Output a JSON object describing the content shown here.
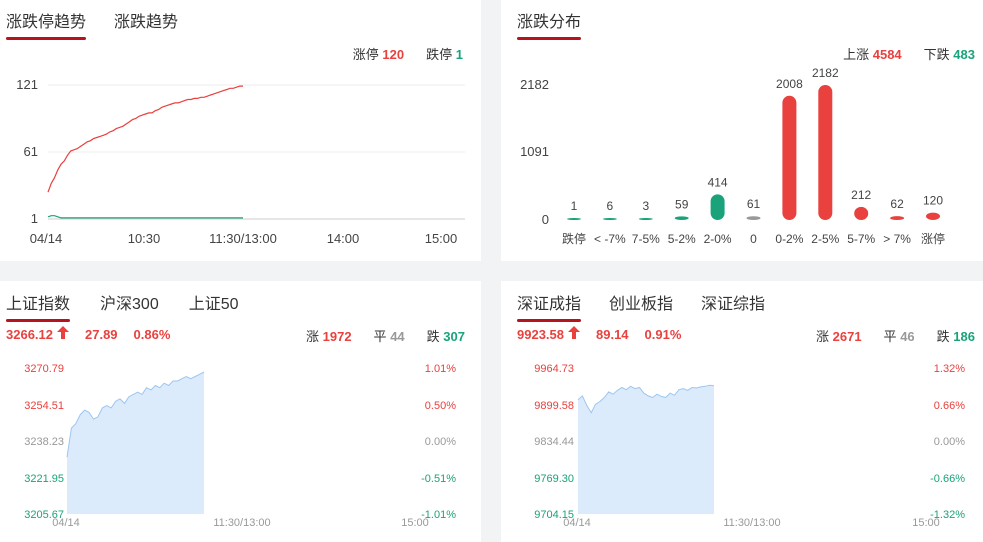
{
  "colors": {
    "up": "#e8413e",
    "down": "#1aa37a",
    "flat": "#999999",
    "accent": "#b5141e",
    "area": "#dcebfb"
  },
  "trend_panel": {
    "tabs": [
      "涨跌停趋势",
      "涨跌趋势"
    ],
    "limit_up_label": "涨停",
    "limit_up_value": "120",
    "limit_down_label": "跌停",
    "limit_down_value": "1",
    "y_ticks": [
      "121",
      "61",
      "1"
    ],
    "x_ticks": [
      "04/14",
      "10:30",
      "11:30/13:00",
      "14:00",
      "15:00"
    ]
  },
  "dist_panel": {
    "title": "涨跌分布",
    "up_label": "上涨",
    "up_value": "4584",
    "down_label": "下跌",
    "down_value": "483",
    "y_ticks": [
      "2182",
      "1091",
      "0"
    ]
  },
  "sh_panel": {
    "tabs": [
      "上证指数",
      "沪深300",
      "上证50"
    ],
    "price": "3266.12",
    "change": "27.89",
    "pct": "0.86%",
    "arrow": "up-arrow-icon",
    "up_label": "涨",
    "up_value": "1972",
    "flat_label": "平",
    "flat_value": "44",
    "down_label": "跌",
    "down_value": "307",
    "y_left": [
      "3270.79",
      "3254.51",
      "3238.23",
      "3221.95",
      "3205.67"
    ],
    "y_right": [
      "1.01%",
      "0.50%",
      "0.00%",
      "-0.51%",
      "-1.01%"
    ],
    "x_ticks": [
      "04/14",
      "11:30/13:00",
      "15:00"
    ]
  },
  "sz_panel": {
    "tabs": [
      "深证成指",
      "创业板指",
      "深证综指"
    ],
    "price": "9923.58",
    "change": "89.14",
    "pct": "0.91%",
    "arrow": "up-arrow-icon",
    "up_label": "涨",
    "up_value": "2671",
    "flat_label": "平",
    "flat_value": "46",
    "down_label": "跌",
    "down_value": "186",
    "y_left": [
      "9964.73",
      "9899.58",
      "9834.44",
      "9769.30",
      "9704.15"
    ],
    "y_right": [
      "1.32%",
      "0.66%",
      "0.00%",
      "-0.66%",
      "-1.32%"
    ],
    "x_ticks": [
      "04/14",
      "11:30/13:00",
      "15:00"
    ]
  },
  "chart_data": [
    {
      "type": "line",
      "x_domain": [
        "09:30",
        "15:00"
      ],
      "ylim": [
        1,
        121
      ],
      "series": [
        {
          "name": "涨停",
          "color": "#e8413e",
          "values": [
            25,
            33,
            38,
            45,
            50,
            53,
            58,
            62,
            63,
            64,
            66,
            68,
            70,
            71,
            73,
            74,
            75,
            76,
            77,
            79,
            80,
            82,
            83,
            84,
            86,
            88,
            90,
            91,
            93,
            94,
            95,
            96,
            96,
            98,
            99,
            101,
            102,
            103,
            104,
            105,
            105,
            106,
            107,
            108,
            108,
            109,
            109,
            110,
            110,
            111,
            112,
            113,
            114,
            115,
            116,
            117,
            118,
            118,
            119,
            120,
            120
          ]
        },
        {
          "name": "跌停",
          "color": "#1aa37a",
          "values": [
            3,
            4,
            4,
            3,
            2,
            2,
            2,
            2,
            2,
            2,
            2,
            2,
            2,
            2,
            2,
            2,
            2,
            2,
            2,
            2,
            2,
            2,
            2,
            2,
            2,
            2,
            2,
            2,
            2,
            2,
            2,
            2,
            2,
            2,
            2,
            2,
            2,
            2,
            2,
            2,
            2,
            2,
            2,
            2,
            2,
            2,
            2,
            2,
            2,
            2,
            2,
            2,
            2,
            2,
            2,
            2,
            2,
            2,
            2,
            2,
            2
          ]
        }
      ]
    },
    {
      "type": "bar",
      "categories": [
        "跌停",
        "< -7%",
        "7-5%",
        "5-2%",
        "2-0%",
        "0",
        "0-2%",
        "2-5%",
        "5-7%",
        "> 7%",
        "涨停"
      ],
      "values": [
        1,
        6,
        3,
        59,
        414,
        61,
        2008,
        2182,
        212,
        62,
        120
      ],
      "bar_colors": [
        "#1aa37a",
        "#1aa37a",
        "#1aa37a",
        "#1aa37a",
        "#1aa37a",
        "#999999",
        "#e8413e",
        "#e8413e",
        "#e8413e",
        "#e8413e",
        "#e8413e"
      ],
      "ylim": [
        0,
        2182
      ]
    },
    {
      "type": "area",
      "x_domain": [
        "09:30",
        "15:00"
      ],
      "ylim": [
        3205.67,
        3270.79
      ],
      "series": [
        {
          "values": [
            3231,
            3244,
            3246,
            3250,
            3252,
            3251,
            3248,
            3249,
            3253,
            3254,
            3253,
            3256,
            3257,
            3255,
            3258,
            3259,
            3260,
            3259,
            3262,
            3261,
            3263,
            3262,
            3264,
            3263,
            3265,
            3265,
            3266,
            3267,
            3266,
            3267,
            3268,
            3269
          ]
        }
      ]
    },
    {
      "type": "area",
      "x_domain": [
        "09:30",
        "15:00"
      ],
      "ylim": [
        9704.15,
        9964.73
      ],
      "series": [
        {
          "values": [
            9908,
            9915,
            9898,
            9885,
            9900,
            9905,
            9912,
            9922,
            9918,
            9925,
            9930,
            9926,
            9932,
            9928,
            9930,
            9920,
            9915,
            9912,
            9918,
            9914,
            9912,
            9920,
            9916,
            9926,
            9928,
            9925,
            9930,
            9929,
            9931,
            9932,
            9934,
            9933
          ]
        }
      ]
    }
  ]
}
